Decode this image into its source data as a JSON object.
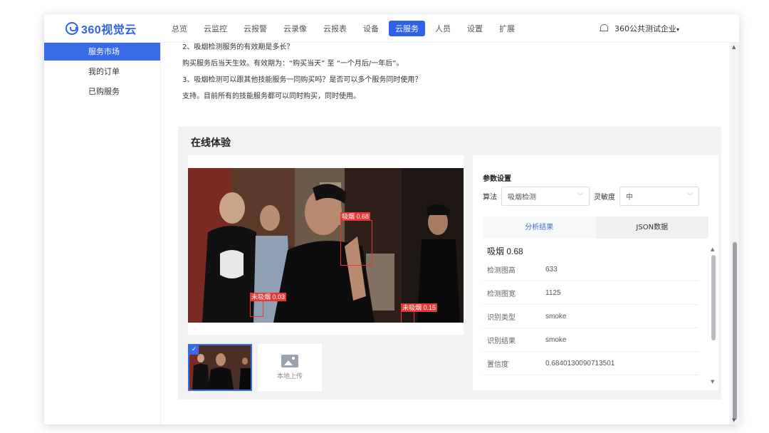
{
  "logo": {
    "text": "360视觉云"
  },
  "nav": [
    {
      "label": "总览",
      "active": false
    },
    {
      "label": "云监控",
      "active": false
    },
    {
      "label": "云报警",
      "active": false
    },
    {
      "label": "云录像",
      "active": false
    },
    {
      "label": "云报表",
      "active": false
    },
    {
      "label": "设备",
      "active": false
    },
    {
      "label": "云服务",
      "active": true
    },
    {
      "label": "人员",
      "active": false
    },
    {
      "label": "设置",
      "active": false
    },
    {
      "label": "扩展",
      "active": false
    }
  ],
  "account": {
    "name": "360公共测试企业",
    "caret": "▾"
  },
  "sidebar": [
    {
      "label": "服务市场",
      "active": true
    },
    {
      "label": "我的订单",
      "active": false
    },
    {
      "label": "已购服务",
      "active": false
    }
  ],
  "faq": [
    "2、吸烟检测服务的有效期是多长？",
    "购买服务后当天生效。有效期为：“购买当天” 至 “一个月后/一年后”。",
    "3、吸烟检测可以跟其他技能服务一同购买吗？是否可以多个服务同时使用？",
    "支持。目前所有的技能服务都可以同时购买，同时使用。"
  ],
  "trial": {
    "title": "在线体验"
  },
  "detections": [
    {
      "label": "吸烟 0.68"
    },
    {
      "label": "未吸烟 0.03"
    },
    {
      "label": "未吸烟 0.15"
    }
  ],
  "thumbs": {
    "check": "✓",
    "upload_label": "本地上传"
  },
  "params": {
    "title": "参数设置",
    "algo_label": "算法",
    "algo_value": "吸烟检测",
    "sens_label": "灵敏度",
    "sens_value": "中"
  },
  "tabs": [
    {
      "label": "分析结果",
      "active": true
    },
    {
      "label": "JSON数据",
      "active": false
    }
  ],
  "result": {
    "head": "吸烟 0.68",
    "rows": [
      {
        "label": "检测图高",
        "value": "633"
      },
      {
        "label": "检测图宽",
        "value": "1125"
      },
      {
        "label": "识别类型",
        "value": "smoke"
      },
      {
        "label": "识别结果",
        "value": "smoke"
      },
      {
        "label": "置信度",
        "value": "0.6840130090713501"
      }
    ]
  },
  "colors": {
    "accent": "#3a6be6",
    "detect": "#e53935"
  }
}
